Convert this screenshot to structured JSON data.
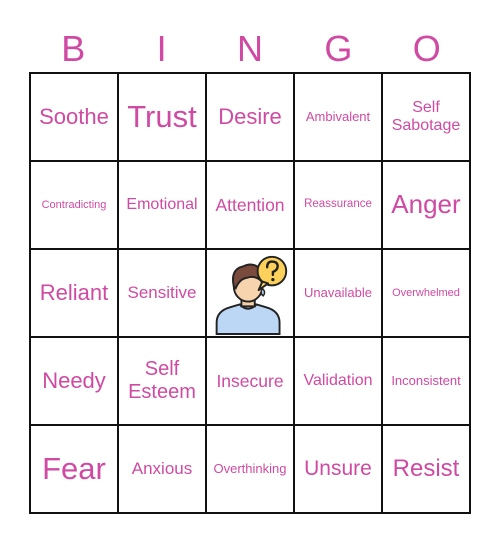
{
  "header": {
    "letters": [
      "B",
      "I",
      "N",
      "G",
      "O"
    ]
  },
  "colors": {
    "text": "#d04aa3",
    "grid": "#111111",
    "background": "#ffffff"
  },
  "board": {
    "rows": [
      [
        {
          "text": "Soothe"
        },
        {
          "text": "Trust"
        },
        {
          "text": "Desire"
        },
        {
          "text": "Ambivalent"
        },
        {
          "text": "Self Sabotage"
        }
      ],
      [
        {
          "text": "Contradicting"
        },
        {
          "text": "Emotional"
        },
        {
          "text": "Attention"
        },
        {
          "text": "Reassurance"
        },
        {
          "text": "Anger"
        }
      ],
      [
        {
          "text": "Reliant"
        },
        {
          "text": "Sensitive"
        },
        {
          "free": true,
          "icon": "confused-person-icon"
        },
        {
          "text": "Unavailable"
        },
        {
          "text": "Overwhelmed"
        }
      ],
      [
        {
          "text": "Needy"
        },
        {
          "text": "Self Esteem"
        },
        {
          "text": "Insecure"
        },
        {
          "text": "Validation"
        },
        {
          "text": "Inconsistent"
        }
      ],
      [
        {
          "text": "Fear"
        },
        {
          "text": "Anxious"
        },
        {
          "text": "Overthinking"
        },
        {
          "text": "Unsure"
        },
        {
          "text": "Resist"
        }
      ]
    ]
  }
}
